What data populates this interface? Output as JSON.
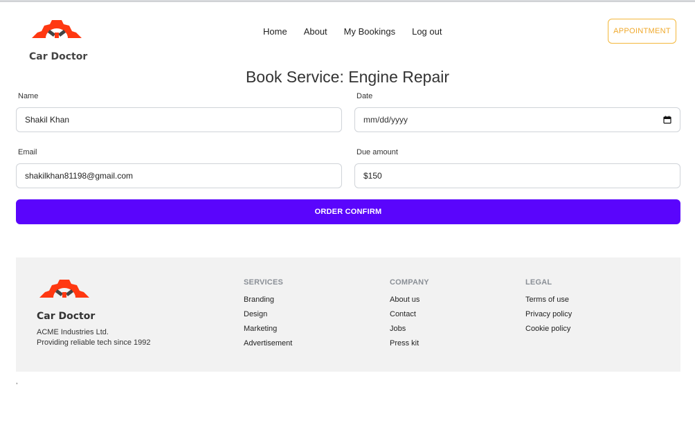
{
  "navbar": {
    "brand_name": "Car Doctor",
    "links": [
      "Home",
      "About",
      "My Bookings",
      "Log out"
    ],
    "appointment_label": "APPOINTMENT"
  },
  "page": {
    "title": "Book Service: Engine Repair"
  },
  "form": {
    "name": {
      "label": "Name",
      "value": "Shakil Khan"
    },
    "date": {
      "label": "Date",
      "placeholder": "mm/dd/yyyy"
    },
    "email": {
      "label": "Email",
      "value": "shakilkhan81198@gmail.com"
    },
    "due": {
      "label": "Due amount",
      "value": "$150"
    },
    "submit_label": "ORDER CONFIRM"
  },
  "footer": {
    "brand_name": "Car Doctor",
    "company_line": "ACME Industries Ltd.",
    "tagline": "Providing reliable tech since 1992",
    "services": {
      "heading": "SERVICES",
      "items": [
        "Branding",
        "Design",
        "Marketing",
        "Advertisement"
      ]
    },
    "company": {
      "heading": "COMPANY",
      "items": [
        "About us",
        "Contact",
        "Jobs",
        "Press kit"
      ]
    },
    "legal": {
      "heading": "LEGAL",
      "items": [
        "Terms of use",
        "Privacy policy",
        "Cookie policy"
      ]
    },
    "stray_mark": ","
  },
  "colors": {
    "brand_orange": "#ff3811",
    "accent_purple": "#5a05fc",
    "appointment_gold": "#f3b73a"
  },
  "icons": [
    "gear-wrench-logo-icon",
    "calendar-icon"
  ]
}
